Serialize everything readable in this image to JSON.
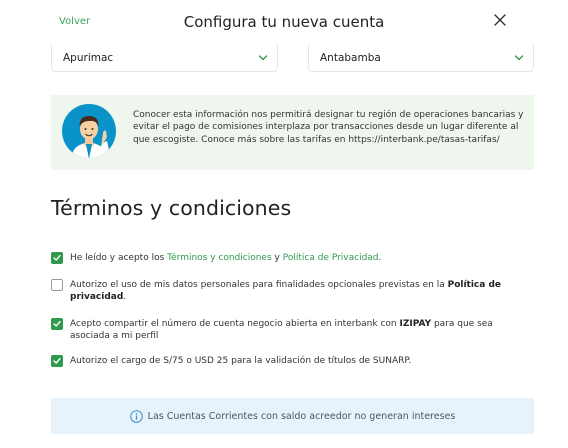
{
  "header": {
    "back_label": "Volver",
    "title": "Configura tu nueva cuenta",
    "close_icon": "close-icon"
  },
  "location": {
    "department": "Apurimac",
    "province": "Antabamba"
  },
  "info": {
    "text": "Conocer esta información nos permitirá designar tu región de operaciones bancarias y evitar el pago de comisiones interplaza por transacciones desde un lugar diferente al que escogiste. Conoce más sobre las tarifas en https://interbank.pe/tasas-tarifas/",
    "avatar_icon": "advisor-avatar-icon"
  },
  "terms": {
    "title": "Términos y condiciones",
    "items": [
      {
        "checked": true,
        "text_before": "He leído y acepto los ",
        "link1": "Términos y condiciones",
        "text_mid": " y ",
        "link2": "Política de Privacidad",
        "text_after": "."
      },
      {
        "checked": false,
        "text_before": "Autorizo el uso de mis datos personales para finalidades opcionales previstas en la ",
        "bold": "Política de privacidad",
        "text_after": "."
      },
      {
        "checked": true,
        "text_before": "Acepto compartir el número de cuenta negocio abierta en interbank con ",
        "bold": "IZIPAY",
        "text_after": " para que sea asociada a mi perfil"
      },
      {
        "checked": true,
        "text": "Autorizo el cargo de S/75 o USD 25 para la validación de títulos de SUNARP."
      }
    ]
  },
  "note": {
    "text": "Las Cuentas Corrientes con saldo acreedor no generan intereses"
  },
  "colors": {
    "accent_green": "#2f9a4e",
    "info_bg": "#eef6ee",
    "note_bg": "#e8f2fa"
  }
}
